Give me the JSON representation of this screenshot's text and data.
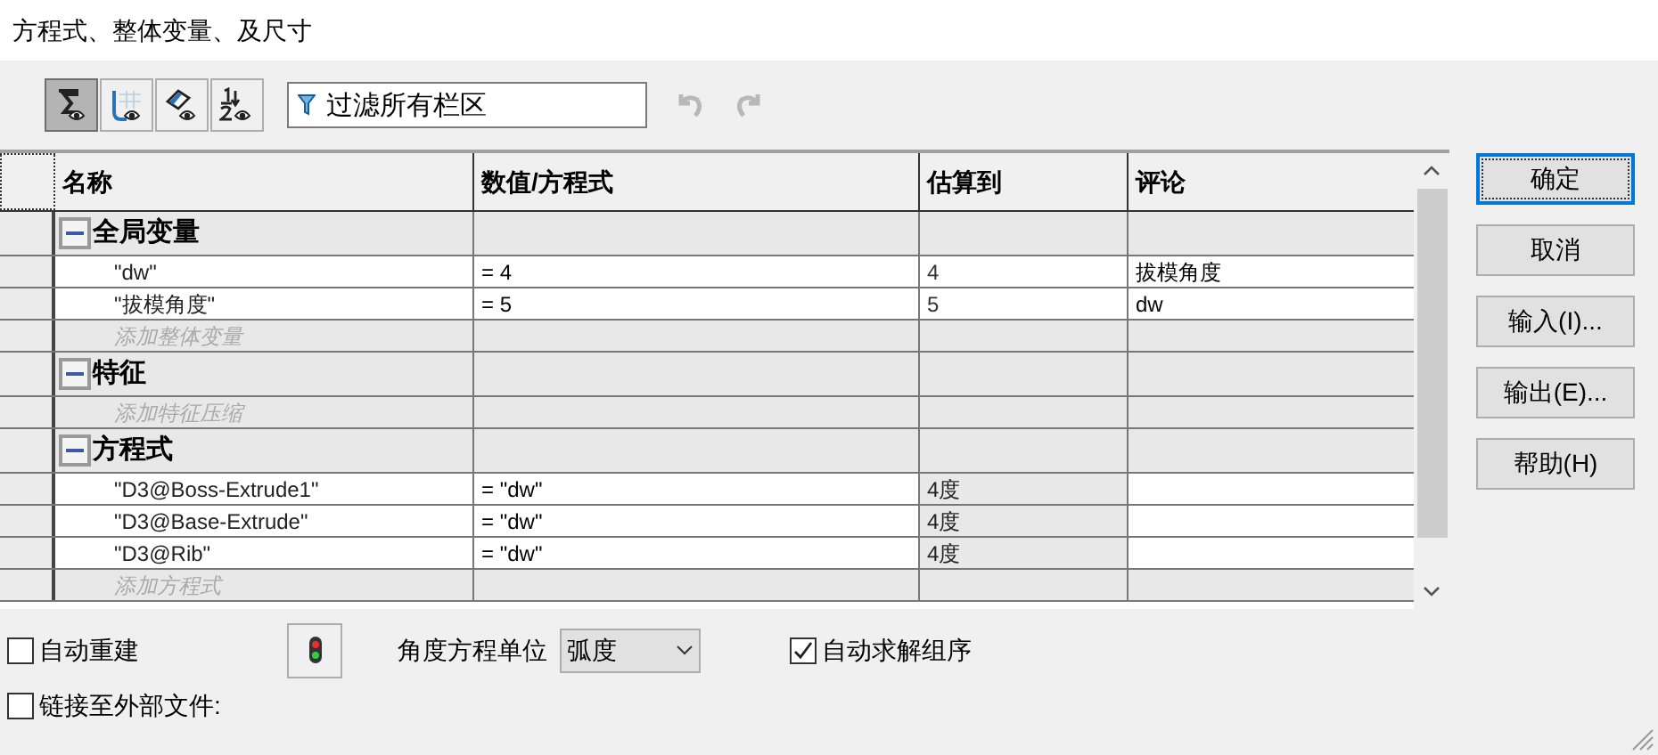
{
  "window": {
    "title": "方程式、整体变量、及尺寸"
  },
  "toolbar": {
    "view_buttons": [
      {
        "kind": "sigma",
        "selected": true
      },
      {
        "kind": "sketch",
        "selected": false
      },
      {
        "kind": "tag",
        "selected": false
      },
      {
        "kind": "order",
        "selected": false
      }
    ],
    "filter": {
      "placeholder": "过滤所有栏区"
    },
    "undo_disabled": true,
    "redo_disabled": true
  },
  "table": {
    "columns": [
      "名称",
      "数值/方程式",
      "估算到",
      "评论"
    ],
    "rows": [
      {
        "kind": "group",
        "name": "全局变量",
        "expanded": true
      },
      {
        "kind": "item",
        "name": "\"dw\"",
        "value": "= 4",
        "evaluated": "4",
        "comment": "拔模角度",
        "linked": false
      },
      {
        "kind": "item",
        "name": "\"拔模角度\"",
        "value": "= 5",
        "evaluated": "5",
        "comment": "dw",
        "linked": false
      },
      {
        "kind": "add",
        "name": "添加整体变量"
      },
      {
        "kind": "group",
        "name": "特征",
        "expanded": true
      },
      {
        "kind": "add",
        "name": "添加特征压缩"
      },
      {
        "kind": "group",
        "name": "方程式",
        "expanded": true
      },
      {
        "kind": "item",
        "name": "\"D3@Boss-Extrude1\"",
        "value": "= \"dw\"",
        "evaluated": "4度",
        "linked": true
      },
      {
        "kind": "item",
        "name": "\"D3@Base-Extrude\"",
        "value": "= \"dw\"",
        "evaluated": "4度",
        "linked": true
      },
      {
        "kind": "item",
        "name": "\"D3@Rib\"",
        "value": "= \"dw\"",
        "evaluated": "4度",
        "linked": true
      },
      {
        "kind": "add",
        "name": "添加方程式"
      }
    ]
  },
  "buttons": [
    {
      "label": "确定",
      "default": true
    },
    {
      "label": "取消",
      "default": false
    },
    {
      "label": "输入(I)...",
      "default": false
    },
    {
      "label": "输出(E)...",
      "default": false
    },
    {
      "label": "帮助(H)",
      "default": false
    }
  ],
  "options": {
    "auto_rebuild": {
      "label": "自动重建",
      "checked": false
    },
    "angle_unit": {
      "label": "角度方程单位",
      "value": "弧度"
    },
    "auto_order": {
      "label": "自动求解组序",
      "checked": true
    },
    "link_external": {
      "label": "链接至外部文件:",
      "checked": false
    }
  }
}
